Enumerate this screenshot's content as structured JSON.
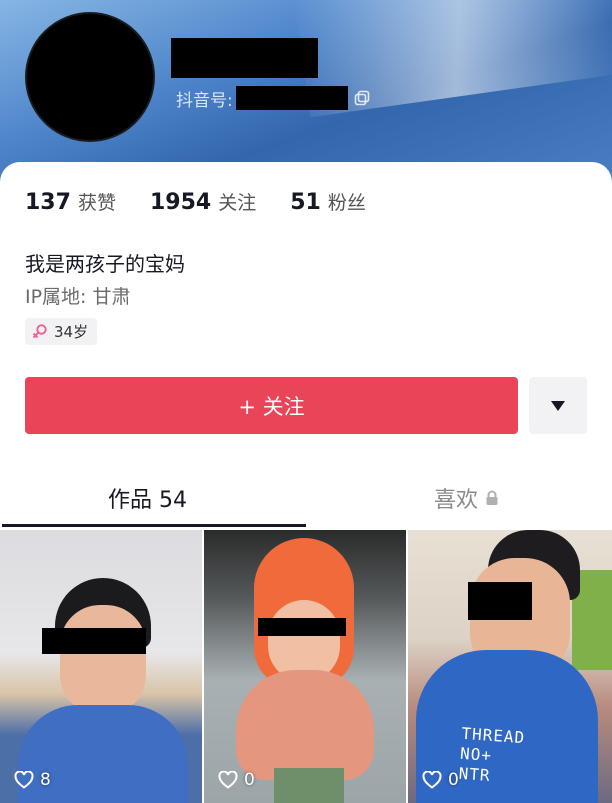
{
  "profile": {
    "douyin_id_label": "抖音号:"
  },
  "stats": [
    {
      "value": "137",
      "label": "获赞"
    },
    {
      "value": "1954",
      "label": "关注"
    },
    {
      "value": "51",
      "label": "粉丝"
    }
  ],
  "bio": "我是两孩子的宝妈",
  "ip_location": "IP属地:  甘肃",
  "age_tag": "34岁",
  "follow_button": "+ 关注",
  "tabs": {
    "works": "作品 54",
    "likes": "喜欢"
  },
  "videos": [
    {
      "likes": "8"
    },
    {
      "likes": "0"
    },
    {
      "likes": "0"
    }
  ],
  "video_overlay_text": [
    "THREAD",
    "NO+",
    "NTR"
  ],
  "colors": {
    "accent": "#ea4459",
    "banner": "#3266ad",
    "text": "#161823"
  }
}
